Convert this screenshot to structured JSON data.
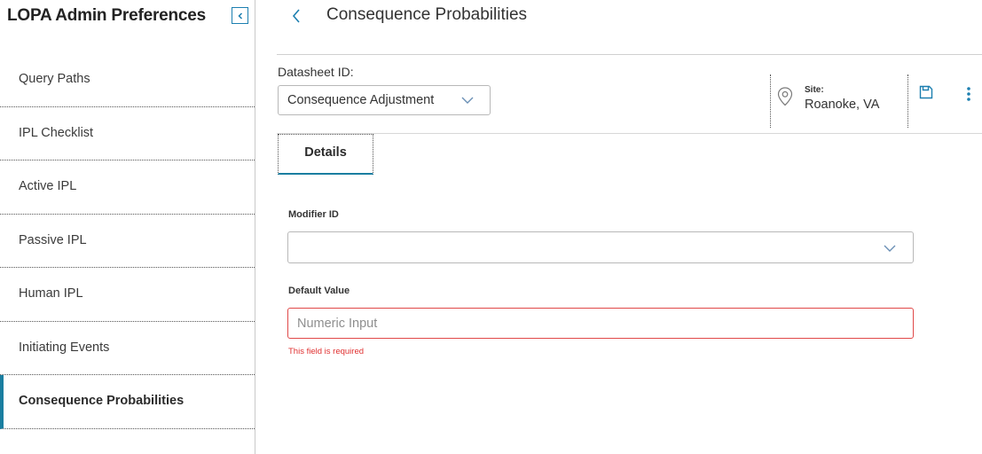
{
  "app": {
    "title": "LOPA Admin Preferences"
  },
  "sidebar": {
    "items": [
      {
        "label": "Query Paths",
        "active": false
      },
      {
        "label": "IPL Checklist",
        "active": false
      },
      {
        "label": "Active IPL",
        "active": false
      },
      {
        "label": "Passive IPL",
        "active": false
      },
      {
        "label": "Human IPL",
        "active": false
      },
      {
        "label": "Initiating Events",
        "active": false
      },
      {
        "label": "Consequence Probabilities",
        "active": true
      }
    ]
  },
  "header": {
    "title": "Consequence Probabilities"
  },
  "datasheet": {
    "label": "Datasheet ID:",
    "value": "Consequence Adjustment"
  },
  "site": {
    "key": "Site:",
    "value": "Roanoke, VA"
  },
  "tabs": [
    {
      "label": "Details",
      "active": true
    }
  ],
  "form": {
    "modifier": {
      "label": "Modifier ID",
      "value": ""
    },
    "default_value": {
      "label": "Default Value",
      "placeholder": "Numeric Input",
      "value": "",
      "error": "This field is required"
    }
  },
  "colors": {
    "accent": "#1a7ea0",
    "error": "#e04848"
  },
  "icons": {
    "collapse": "collapse-sidebar-icon",
    "back": "chevron-left-icon",
    "dropdown": "chevron-down-icon",
    "site": "location-pin-icon",
    "save": "save-icon",
    "more": "more-vertical-icon"
  }
}
